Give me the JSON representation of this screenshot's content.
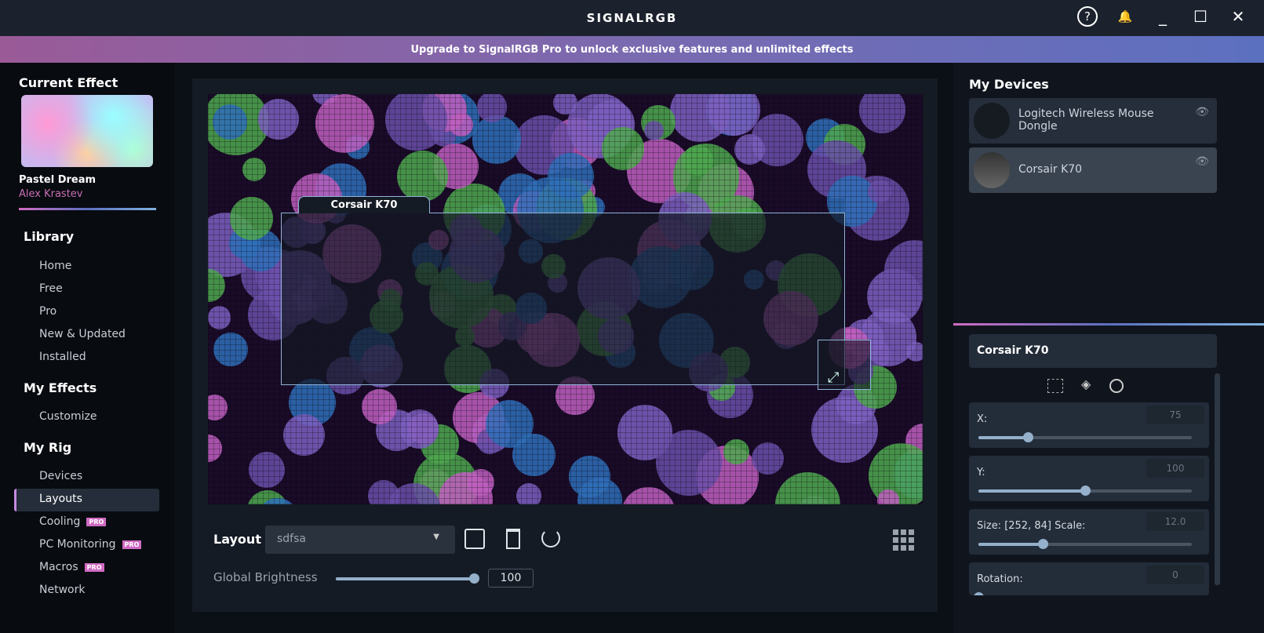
{
  "app": {
    "title": "SIGNALRGB"
  },
  "titlebar": {
    "help": "?",
    "bell": "🔔",
    "minimize": "_",
    "maximize": "☐",
    "close": "✕"
  },
  "banner": "Upgrade to SignalRGB Pro to unlock exclusive features and unlimited effects",
  "sidebar": {
    "current_effect_heading": "Current Effect",
    "effect_name": "Pastel Dream",
    "effect_author": "Alex Krastev",
    "library_heading": "Library",
    "library": [
      "Home",
      "Free",
      "Pro",
      "New & Updated",
      "Installed"
    ],
    "my_effects_heading": "My Effects",
    "my_effects": [
      "Customize"
    ],
    "my_rig_heading": "My Rig",
    "my_rig": [
      "Devices",
      "Layouts",
      "Cooling",
      "PC Monitoring",
      "Macros",
      "Network"
    ],
    "pro_badge": "PRO",
    "selected": "Layouts"
  },
  "canvas": {
    "device_label": "Corsair K70",
    "resize_icon": "⤢"
  },
  "layout_bar": {
    "label": "Layout",
    "selected": "sdfsa",
    "save": "save-icon",
    "delete": "trash-icon",
    "reset": "reset-icon",
    "grid": "grid-icon"
  },
  "brightness": {
    "label": "Global Brightness",
    "value": "100",
    "fraction": 1.0
  },
  "devices": {
    "heading": "My Devices",
    "items": [
      {
        "name": "Logitech Wireless Mouse Dongle"
      },
      {
        "name": "Corsair K70"
      }
    ]
  },
  "props": {
    "title": "Corsair K70",
    "fields": [
      {
        "label": "X:",
        "value": "75",
        "fraction": 0.23
      },
      {
        "label": "Y:",
        "value": "100",
        "fraction": 0.5
      },
      {
        "label": "Size: [252, 84] Scale:",
        "value": "12.0",
        "fraction": 0.3
      },
      {
        "label": "Rotation:",
        "value": "0",
        "fraction": 0.0
      }
    ]
  },
  "colors": {
    "accent_pink": "#d06bc3",
    "accent_blue": "#7fb2e0",
    "author": "#c96fb5"
  }
}
